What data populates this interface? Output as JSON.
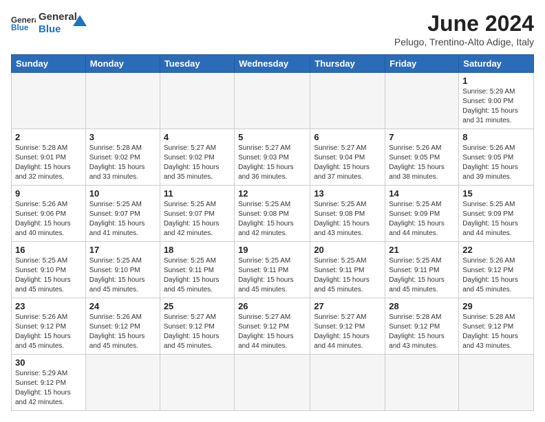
{
  "header": {
    "logo_general": "General",
    "logo_blue": "Blue",
    "month_title": "June 2024",
    "subtitle": "Pelugo, Trentino-Alto Adige, Italy"
  },
  "weekdays": [
    "Sunday",
    "Monday",
    "Tuesday",
    "Wednesday",
    "Thursday",
    "Friday",
    "Saturday"
  ],
  "weeks": [
    [
      {
        "day": "",
        "info": ""
      },
      {
        "day": "",
        "info": ""
      },
      {
        "day": "",
        "info": ""
      },
      {
        "day": "",
        "info": ""
      },
      {
        "day": "",
        "info": ""
      },
      {
        "day": "",
        "info": ""
      },
      {
        "day": "1",
        "info": "Sunrise: 5:29 AM\nSunset: 9:00 PM\nDaylight: 15 hours\nand 31 minutes."
      }
    ],
    [
      {
        "day": "2",
        "info": "Sunrise: 5:28 AM\nSunset: 9:01 PM\nDaylight: 15 hours\nand 32 minutes."
      },
      {
        "day": "3",
        "info": "Sunrise: 5:28 AM\nSunset: 9:02 PM\nDaylight: 15 hours\nand 33 minutes."
      },
      {
        "day": "4",
        "info": "Sunrise: 5:27 AM\nSunset: 9:02 PM\nDaylight: 15 hours\nand 35 minutes."
      },
      {
        "day": "5",
        "info": "Sunrise: 5:27 AM\nSunset: 9:03 PM\nDaylight: 15 hours\nand 36 minutes."
      },
      {
        "day": "6",
        "info": "Sunrise: 5:27 AM\nSunset: 9:04 PM\nDaylight: 15 hours\nand 37 minutes."
      },
      {
        "day": "7",
        "info": "Sunrise: 5:26 AM\nSunset: 9:05 PM\nDaylight: 15 hours\nand 38 minutes."
      },
      {
        "day": "8",
        "info": "Sunrise: 5:26 AM\nSunset: 9:05 PM\nDaylight: 15 hours\nand 39 minutes."
      }
    ],
    [
      {
        "day": "9",
        "info": "Sunrise: 5:26 AM\nSunset: 9:06 PM\nDaylight: 15 hours\nand 40 minutes."
      },
      {
        "day": "10",
        "info": "Sunrise: 5:25 AM\nSunset: 9:07 PM\nDaylight: 15 hours\nand 41 minutes."
      },
      {
        "day": "11",
        "info": "Sunrise: 5:25 AM\nSunset: 9:07 PM\nDaylight: 15 hours\nand 42 minutes."
      },
      {
        "day": "12",
        "info": "Sunrise: 5:25 AM\nSunset: 9:08 PM\nDaylight: 15 hours\nand 42 minutes."
      },
      {
        "day": "13",
        "info": "Sunrise: 5:25 AM\nSunset: 9:08 PM\nDaylight: 15 hours\nand 43 minutes."
      },
      {
        "day": "14",
        "info": "Sunrise: 5:25 AM\nSunset: 9:09 PM\nDaylight: 15 hours\nand 44 minutes."
      },
      {
        "day": "15",
        "info": "Sunrise: 5:25 AM\nSunset: 9:09 PM\nDaylight: 15 hours\nand 44 minutes."
      }
    ],
    [
      {
        "day": "16",
        "info": "Sunrise: 5:25 AM\nSunset: 9:10 PM\nDaylight: 15 hours\nand 45 minutes."
      },
      {
        "day": "17",
        "info": "Sunrise: 5:25 AM\nSunset: 9:10 PM\nDaylight: 15 hours\nand 45 minutes."
      },
      {
        "day": "18",
        "info": "Sunrise: 5:25 AM\nSunset: 9:11 PM\nDaylight: 15 hours\nand 45 minutes."
      },
      {
        "day": "19",
        "info": "Sunrise: 5:25 AM\nSunset: 9:11 PM\nDaylight: 15 hours\nand 45 minutes."
      },
      {
        "day": "20",
        "info": "Sunrise: 5:25 AM\nSunset: 9:11 PM\nDaylight: 15 hours\nand 45 minutes."
      },
      {
        "day": "21",
        "info": "Sunrise: 5:25 AM\nSunset: 9:11 PM\nDaylight: 15 hours\nand 45 minutes."
      },
      {
        "day": "22",
        "info": "Sunrise: 5:26 AM\nSunset: 9:12 PM\nDaylight: 15 hours\nand 45 minutes."
      }
    ],
    [
      {
        "day": "23",
        "info": "Sunrise: 5:26 AM\nSunset: 9:12 PM\nDaylight: 15 hours\nand 45 minutes."
      },
      {
        "day": "24",
        "info": "Sunrise: 5:26 AM\nSunset: 9:12 PM\nDaylight: 15 hours\nand 45 minutes."
      },
      {
        "day": "25",
        "info": "Sunrise: 5:27 AM\nSunset: 9:12 PM\nDaylight: 15 hours\nand 45 minutes."
      },
      {
        "day": "26",
        "info": "Sunrise: 5:27 AM\nSunset: 9:12 PM\nDaylight: 15 hours\nand 44 minutes."
      },
      {
        "day": "27",
        "info": "Sunrise: 5:27 AM\nSunset: 9:12 PM\nDaylight: 15 hours\nand 44 minutes."
      },
      {
        "day": "28",
        "info": "Sunrise: 5:28 AM\nSunset: 9:12 PM\nDaylight: 15 hours\nand 43 minutes."
      },
      {
        "day": "29",
        "info": "Sunrise: 5:28 AM\nSunset: 9:12 PM\nDaylight: 15 hours\nand 43 minutes."
      }
    ],
    [
      {
        "day": "30",
        "info": "Sunrise: 5:29 AM\nSunset: 9:12 PM\nDaylight: 15 hours\nand 42 minutes."
      },
      {
        "day": "",
        "info": ""
      },
      {
        "day": "",
        "info": ""
      },
      {
        "day": "",
        "info": ""
      },
      {
        "day": "",
        "info": ""
      },
      {
        "day": "",
        "info": ""
      },
      {
        "day": "",
        "info": ""
      }
    ]
  ]
}
